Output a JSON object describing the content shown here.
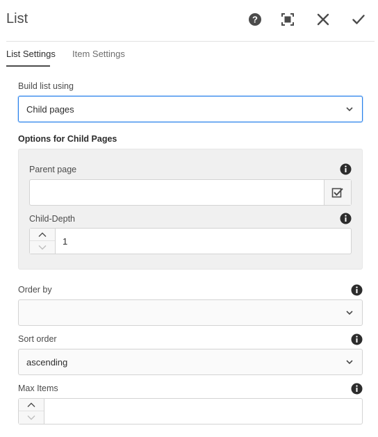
{
  "dialog": {
    "title": "List",
    "help_icon": "help-icon",
    "fullscreen_icon": "fullscreen-icon",
    "close_icon": "close-icon",
    "done_icon": "checkmark-icon"
  },
  "tabs": [
    {
      "label": "List Settings",
      "active": true
    },
    {
      "label": "Item Settings",
      "active": false
    }
  ],
  "build_list": {
    "label": "Build list using",
    "value": "Child pages"
  },
  "child_pages": {
    "section_title": "Options for Child Pages",
    "parent_page": {
      "label": "Parent page",
      "value": ""
    },
    "child_depth": {
      "label": "Child-Depth",
      "value": "1"
    }
  },
  "order_by": {
    "label": "Order by",
    "value": ""
  },
  "sort_order": {
    "label": "Sort order",
    "value": "ascending"
  },
  "max_items": {
    "label": "Max Items",
    "value": ""
  },
  "colors": {
    "focus_border": "#2680eb",
    "text": "#4b4b4b",
    "panel_bg": "#f0f0f0"
  }
}
